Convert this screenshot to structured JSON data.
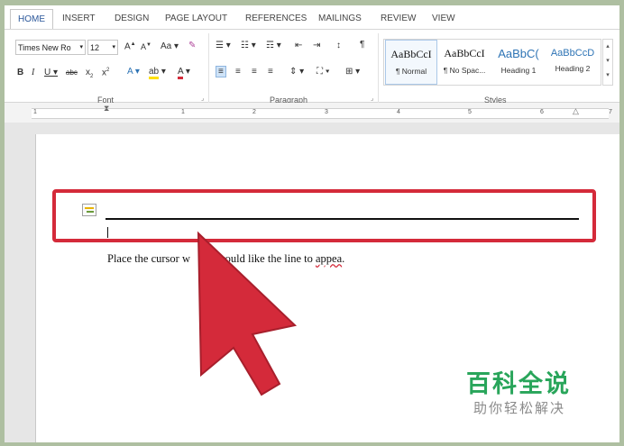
{
  "tabs": [
    "HOME",
    "INSERT",
    "DESIGN",
    "PAGE LAYOUT",
    "REFERENCES",
    "MAILINGS",
    "REVIEW",
    "VIEW"
  ],
  "font": {
    "name": "Times New Ro",
    "size": "12",
    "group_label": "Font"
  },
  "paragraph": {
    "group_label": "Paragraph"
  },
  "styles": {
    "group_label": "Styles",
    "items": [
      {
        "sample": "AaBbCcI",
        "name": "¶ Normal"
      },
      {
        "sample": "AaBbCcI",
        "name": "¶ No Spac..."
      },
      {
        "sample": "AaBbC(",
        "name": "Heading 1"
      },
      {
        "sample": "AaBbCcD",
        "name": "Heading 2"
      }
    ]
  },
  "ruler_numbers": [
    "1",
    "1",
    "2",
    "3",
    "4",
    "5",
    "6",
    "7"
  ],
  "document": {
    "text_before": "Place the cursor w",
    "text_after": "ou would like the line to ",
    "text_misspelled": "appea",
    "text_end": "."
  },
  "watermark": {
    "title": "百科全说",
    "subtitle": "助你轻松解决"
  },
  "colors": {
    "accent": "#2b579a",
    "highlight": "#d42a3a",
    "watermark": "#28a55a"
  }
}
